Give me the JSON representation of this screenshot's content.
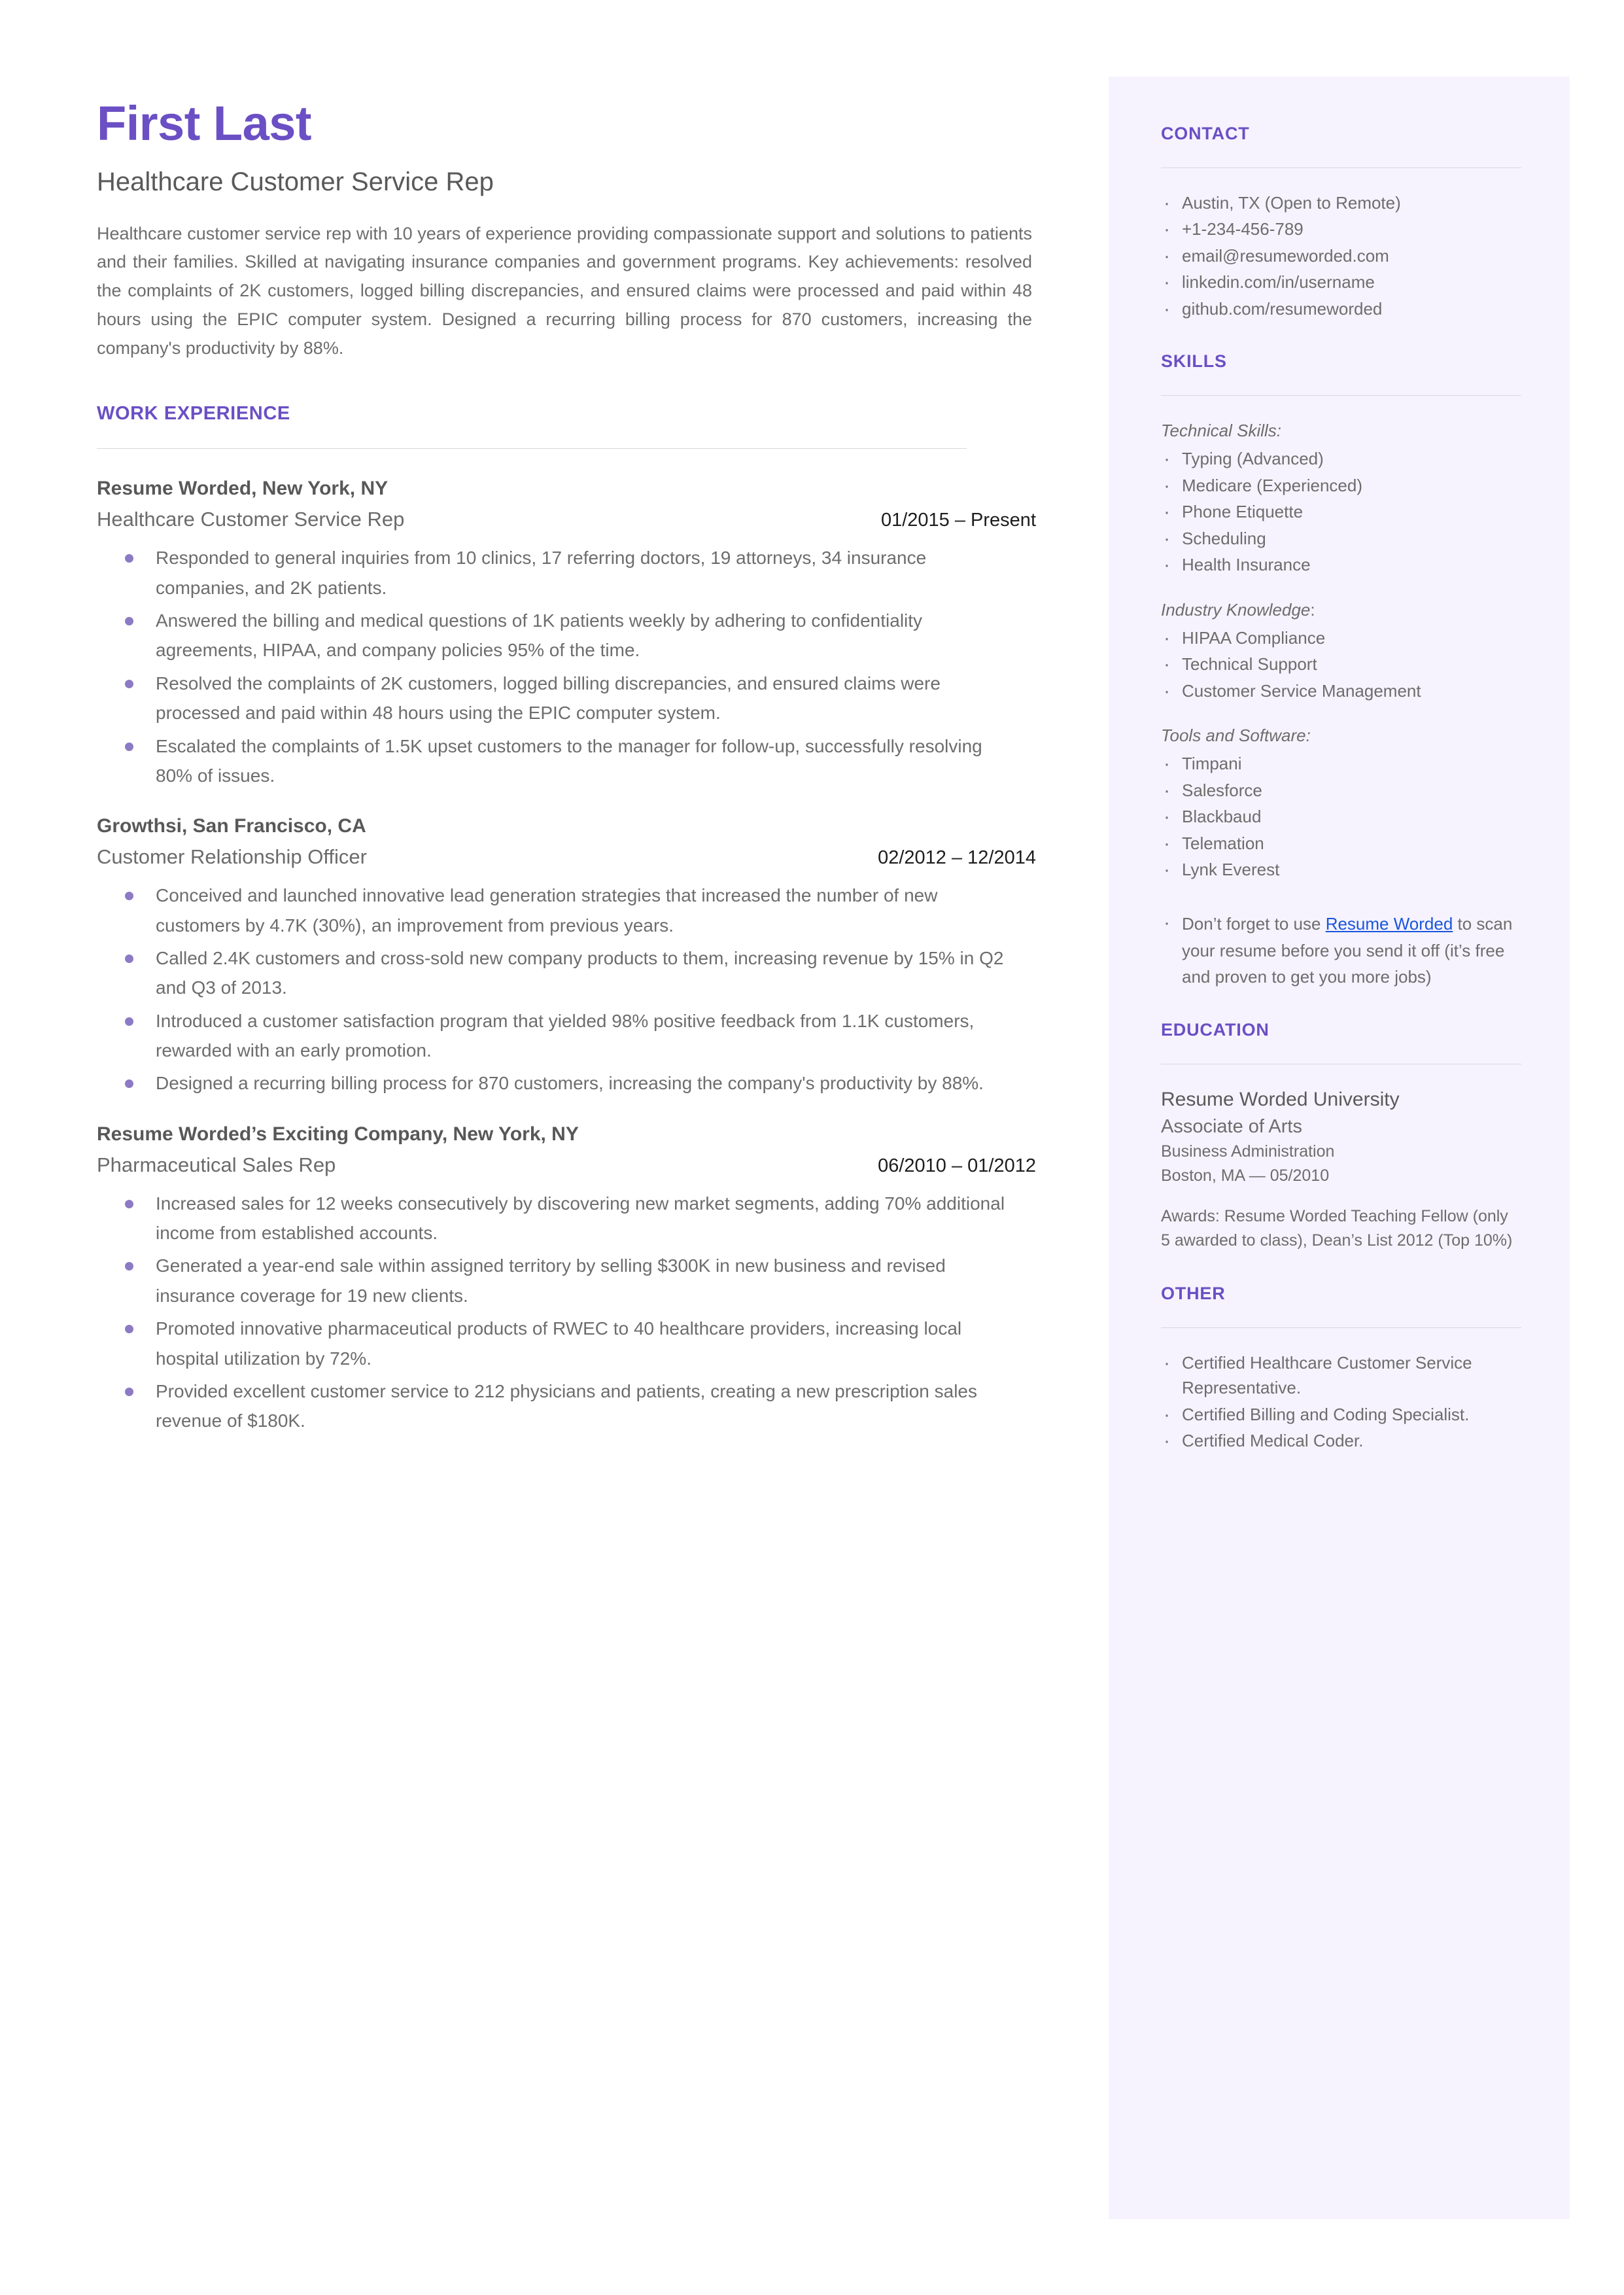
{
  "header": {
    "name": "First Last",
    "headline": "Healthcare Customer Service Rep",
    "summary": "Healthcare customer service rep with 10 years of experience providing compassionate support and solutions to patients and their families. Skilled at navigating insurance companies and government programs. Key achievements: resolved the complaints of 2K customers, logged billing discrepancies, and ensured claims were processed and paid within 48 hours using the EPIC computer system. Designed a recurring billing process for 870 customers, increasing the company's productivity by 88%."
  },
  "work": {
    "section_title": "WORK EXPERIENCE",
    "jobs": [
      {
        "company": "Resume Worded, New York, NY",
        "title": "Healthcare Customer Service Rep",
        "dates": "01/2015 – Present",
        "bullets": [
          "Responded to general inquiries from 10 clinics, 17 referring doctors, 19 attorneys, 34 insurance companies, and 2K patients.",
          "Answered the billing and medical questions of 1K patients weekly by adhering to confidentiality agreements, HIPAA, and company policies 95% of the time.",
          "Resolved the complaints of 2K customers, logged billing discrepancies, and ensured claims were processed and paid within 48 hours using the EPIC computer system.",
          "Escalated the complaints of 1.5K upset customers to the manager for follow-up, successfully resolving 80% of issues."
        ]
      },
      {
        "company": "Growthsi, San Francisco, CA",
        "title": "Customer Relationship Officer",
        "dates": "02/2012 – 12/2014",
        "bullets": [
          "Conceived and launched innovative lead generation strategies that increased the number of new customers by 4.7K (30%), an improvement from previous years.",
          "Called 2.4K customers and cross-sold new company products to them, increasing revenue by 15% in Q2 and Q3 of 2013.",
          "Introduced a customer satisfaction program that yielded 98% positive feedback from 1.1K customers, rewarded with an early promotion.",
          "Designed a recurring billing process for 870 customers, increasing the company's productivity by 88%."
        ]
      },
      {
        "company": "Resume Worded’s Exciting Company, New York, NY",
        "title": "Pharmaceutical Sales Rep",
        "dates": "06/2010 – 01/2012",
        "bullets": [
          "Increased sales for 12 weeks consecutively by discovering new market segments, adding 70% additional income from established accounts.",
          "Generated a year-end sale within assigned territory by selling $300K in new business and revised insurance coverage for 19 new clients.",
          "Promoted innovative pharmaceutical products of RWEC to 40 healthcare providers, increasing local hospital utilization by 72%.",
          "Provided excellent customer service to 212 physicians and patients, creating a new prescription sales revenue of  $180K."
        ]
      }
    ]
  },
  "contact": {
    "section_title": "CONTACT",
    "items": [
      "Austin, TX (Open to Remote)",
      "+1-234-456-789",
      "email@resumeworded.com",
      "linkedin.com/in/username",
      "github.com/resumeworded"
    ]
  },
  "skills": {
    "section_title": "SKILLS",
    "groups": [
      {
        "label": "Technical Skills:",
        "label_plain_suffix": "",
        "items": [
          "Typing (Advanced)",
          "Medicare (Experienced)",
          "Phone Etiquette",
          "Scheduling",
          "Health Insurance"
        ]
      },
      {
        "label": "Industry Knowledge",
        "label_plain_suffix": ":",
        "items": [
          "HIPAA Compliance",
          "Technical Support",
          "Customer Service Management"
        ]
      },
      {
        "label": "Tools and Software:",
        "label_plain_suffix": "",
        "items": [
          "Timpani",
          "Salesforce",
          "Blackbaud",
          "Telemation",
          "Lynk Everest"
        ]
      }
    ],
    "promo": {
      "before": "Don’t forget to use ",
      "link": "Resume Worded",
      "after": " to scan your resume before you send it off (it’s free and proven to get you more jobs)"
    }
  },
  "education": {
    "section_title": "EDUCATION",
    "school": "Resume Worded University",
    "degree": "Associate of Arts",
    "field": "Business Administration",
    "location": "Boston, MA — 05/2010",
    "awards": "Awards: Resume Worded Teaching Fellow (only 5 awarded to class), Dean’s List 2012 (Top 10%)"
  },
  "other": {
    "section_title": "OTHER",
    "items": [
      "Certified Healthcare Customer Service Representative.",
      "Certified Billing and Coding Specialist.",
      "Certified Medical Coder."
    ]
  },
  "colors": {
    "accent": "#6b4fc4",
    "sidebar_bg": "#f6f3fe",
    "body_text": "#6d6d6d",
    "link": "#1a56db",
    "bullet": "#8d7ac4"
  }
}
